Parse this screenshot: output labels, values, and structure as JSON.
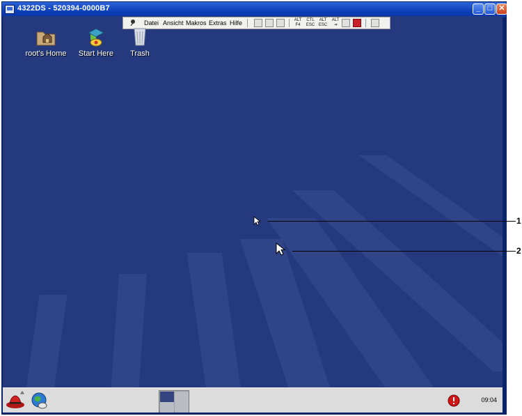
{
  "window": {
    "title": "4322DS - 520394-0000B7"
  },
  "remote_toolbar": {
    "menus": [
      "Datei",
      "Ansicht",
      "Makros",
      "Extras",
      "Hilfe"
    ],
    "key_buttons": [
      {
        "top": "ALT",
        "bottom": "F4"
      },
      {
        "top": "CTL",
        "bottom": "ESC"
      },
      {
        "top": "ALT",
        "bottom": "ESC"
      },
      {
        "top": "ALT",
        "bottom": "⇥"
      }
    ]
  },
  "desktop_icons": [
    {
      "label": "root's Home",
      "icon": "home-folder-icon"
    },
    {
      "label": "Start Here",
      "icon": "start-here-icon"
    },
    {
      "label": "Trash",
      "icon": "trash-icon"
    }
  ],
  "callouts": [
    "1",
    "2"
  ],
  "taskbar": {
    "clock": "09:04"
  },
  "colors": {
    "desktop": "#253a7e",
    "titlebar": "#0b3fb8",
    "taskbar": "#dcdcdc"
  }
}
